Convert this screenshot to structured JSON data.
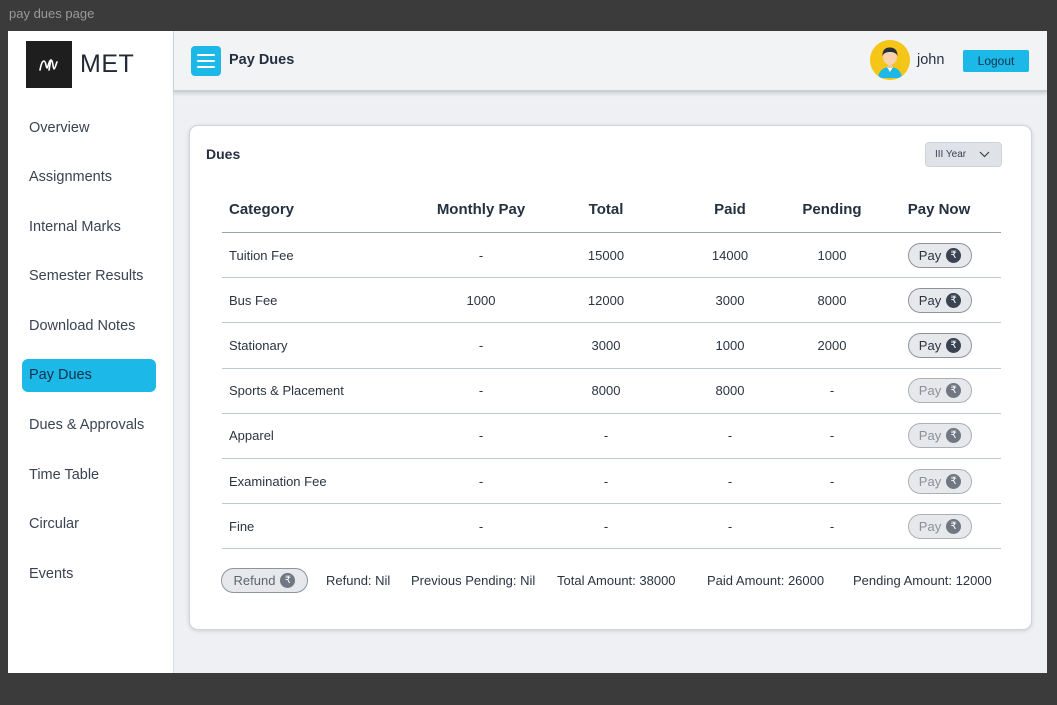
{
  "frame_label": "pay dues page",
  "logo": {
    "text": "MET"
  },
  "sidebar": {
    "items": [
      {
        "label": "Overview",
        "active": false
      },
      {
        "label": "Assignments",
        "active": false
      },
      {
        "label": "Internal Marks",
        "active": false
      },
      {
        "label": "Semester Results",
        "active": false
      },
      {
        "label": "Download Notes",
        "active": false
      },
      {
        "label": "Pay Dues",
        "active": true
      },
      {
        "label": "Dues & Approvals",
        "active": false
      },
      {
        "label": "Time Table",
        "active": false
      },
      {
        "label": "Circular",
        "active": false
      },
      {
        "label": "Events",
        "active": false
      }
    ]
  },
  "header": {
    "title": "Pay Dues",
    "user": "john",
    "logout_label": "Logout"
  },
  "dues": {
    "title": "Dues",
    "year_select": "III Year",
    "columns": [
      "Category",
      "Monthly Pay",
      "Total",
      "Paid",
      "Pending",
      "Pay Now"
    ],
    "pay_label": "Pay",
    "rows": [
      {
        "category": "Tuition Fee",
        "monthly": "-",
        "total": "15000",
        "paid": "14000",
        "pending": "1000",
        "payable": true
      },
      {
        "category": "Bus Fee",
        "monthly": "1000",
        "total": "12000",
        "paid": "3000",
        "pending": "8000",
        "payable": true
      },
      {
        "category": "Stationary",
        "monthly": "-",
        "total": "3000",
        "paid": "1000",
        "pending": "2000",
        "payable": true
      },
      {
        "category": "Sports & Placement",
        "monthly": "-",
        "total": "8000",
        "paid": "8000",
        "pending": "-",
        "payable": false
      },
      {
        "category": "Apparel",
        "monthly": "-",
        "total": "-",
        "paid": "-",
        "pending": "-",
        "payable": false
      },
      {
        "category": "Examination Fee",
        "monthly": "-",
        "total": "-",
        "paid": "-",
        "pending": "-",
        "payable": false
      },
      {
        "category": "Fine",
        "monthly": "-",
        "total": "-",
        "paid": "-",
        "pending": "-",
        "payable": false
      }
    ],
    "summary": {
      "refund_button": "Refund",
      "refund": "Refund: Nil",
      "previous_pending": "Previous Pending: Nil",
      "total_amount": "Total Amount: 38000",
      "paid_amount": "Paid Amount: 26000",
      "pending_amount": "Pending Amount: 12000"
    }
  },
  "colors": {
    "accent": "#1bb8e8",
    "avatar_bg": "#f5c518",
    "sidebar_bg": "#ffffff",
    "content_bg": "#eef0f3"
  },
  "icons": {
    "menu": "hamburger-icon",
    "currency": "rupee-icon",
    "dropdown": "chevron-down-icon",
    "user": "avatar-icon"
  }
}
